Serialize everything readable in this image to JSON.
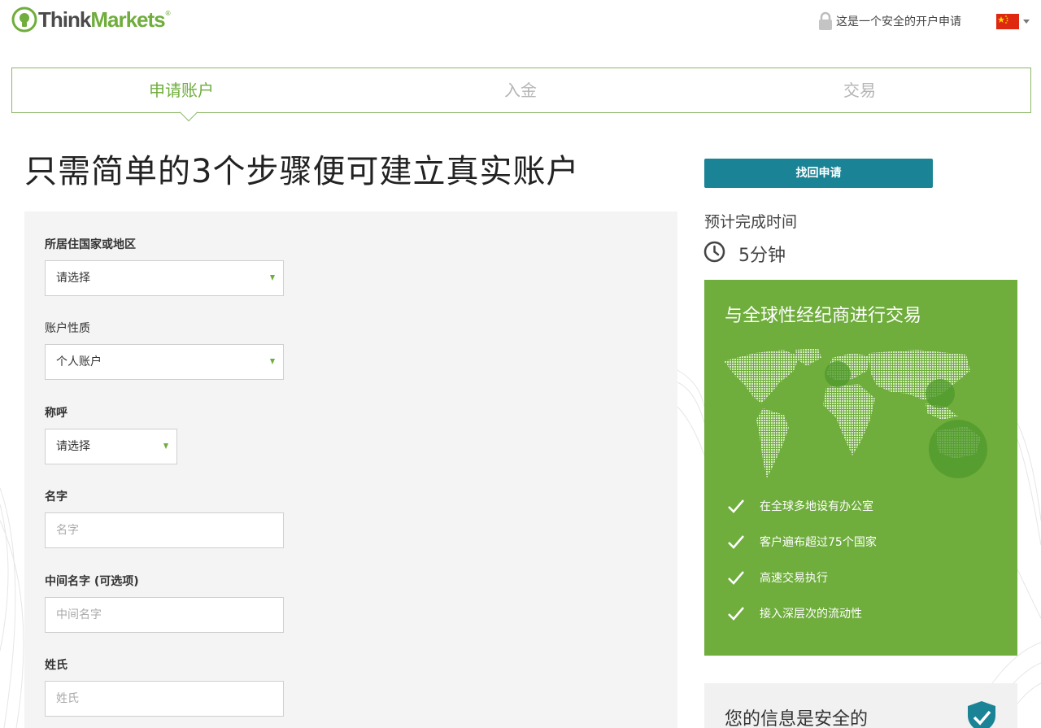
{
  "header": {
    "logo_think": "Think",
    "logo_markets": "Markets",
    "logo_reg": "®",
    "secure_note": "这是一个安全的开户申请",
    "flag_icon": "china-flag-icon",
    "lock_icon": "lock-icon"
  },
  "steps": [
    {
      "label": "申请账户",
      "active": true
    },
    {
      "label": "入金",
      "active": false
    },
    {
      "label": "交易",
      "active": false
    }
  ],
  "main_title": "只需简单的3个步骤便可建立真实账户",
  "form": {
    "country_label": "所居住国家或地区",
    "country_value": "请选择",
    "account_type_label": "账户性质",
    "account_type_value": "个人账户",
    "salutation_label": "称呼",
    "salutation_value": "请选择",
    "first_name_label": "名字",
    "first_name_placeholder": "名字",
    "middle_name_label": "中间名字 (可选项)",
    "middle_name_placeholder": "中间名字",
    "last_name_label": "姓氏",
    "last_name_placeholder": "姓氏"
  },
  "sidebar": {
    "retrieve_button": "找回申请",
    "eta_label": "预计完成时间",
    "eta_value": "5分钟",
    "promo_title": "与全球性经纪商进行交易",
    "benefits": [
      "在全球多地设有办公室",
      "客户遍布超过75个国家",
      "高速交易执行",
      "接入深层次的流动性"
    ],
    "secure_title": "您的信息是安全的"
  },
  "colors": {
    "brand_green": "#6fad3c",
    "button_teal": "#1a8496",
    "panel_gray": "#f4f4f4"
  }
}
